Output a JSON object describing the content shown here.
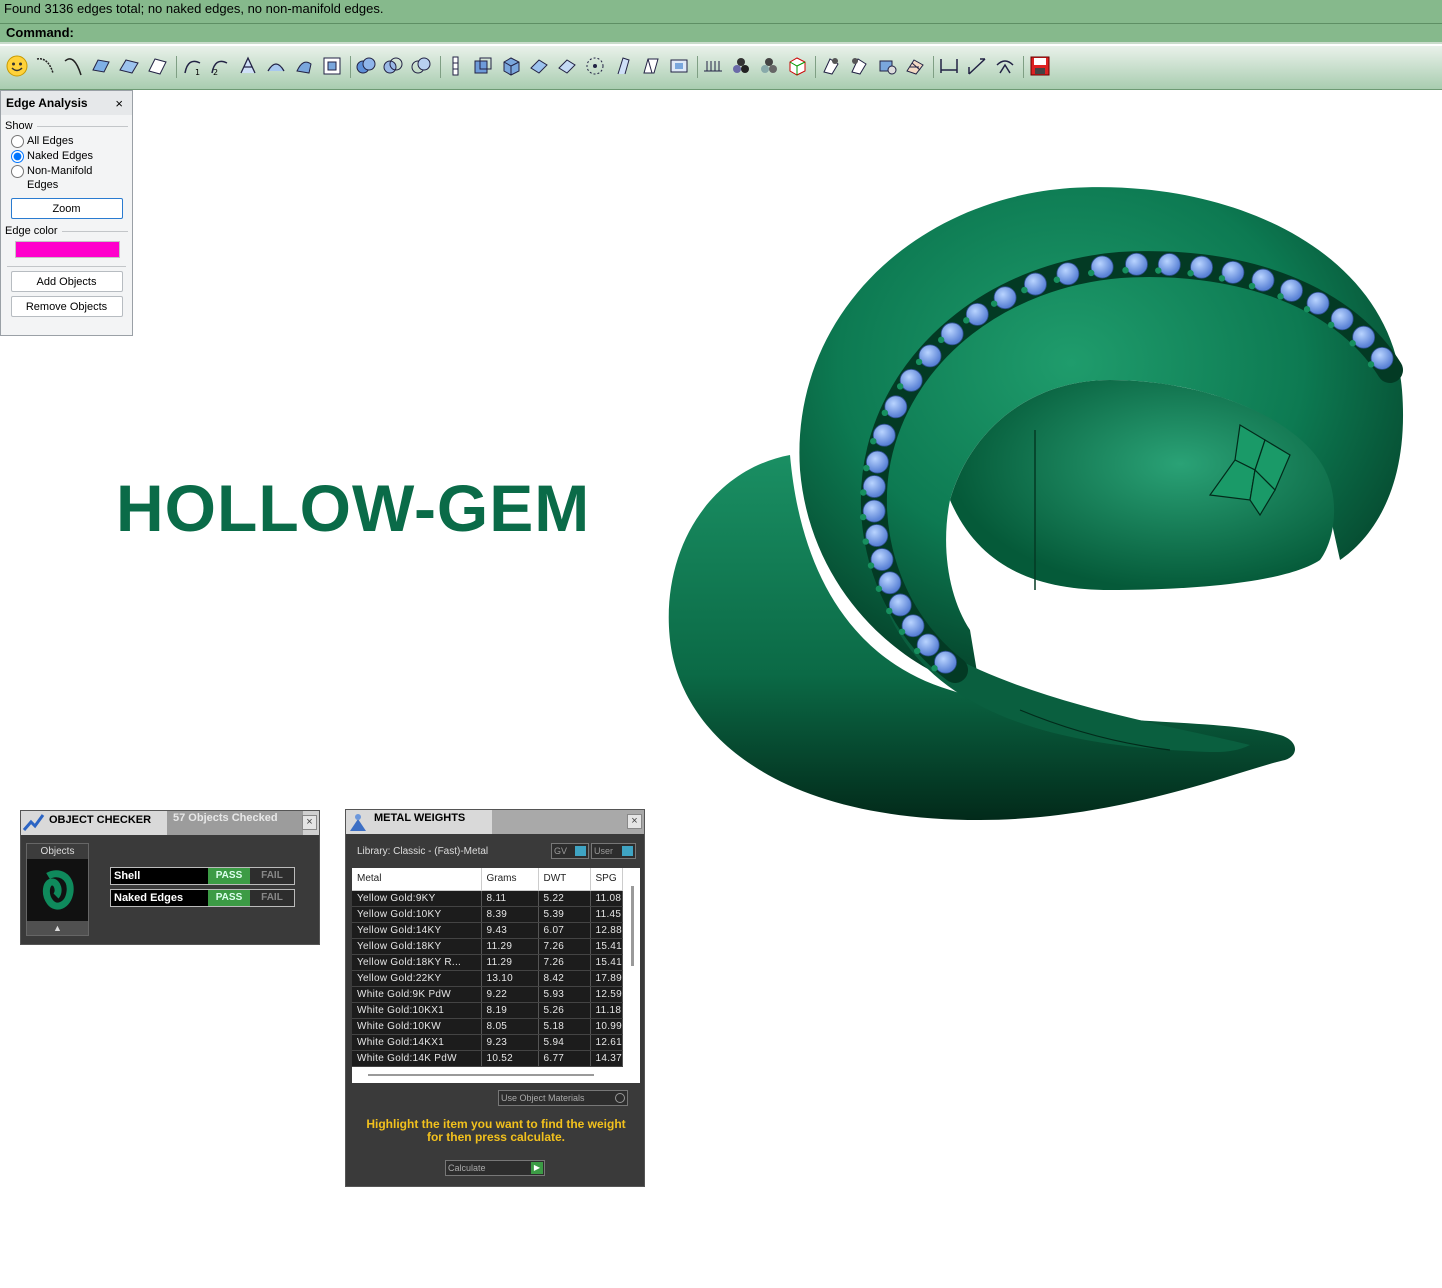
{
  "command": {
    "history": "Found 3136 edges total; no naked edges, no non-manifold edges.",
    "prompt": "Command:"
  },
  "toolbar": {
    "icons": [
      "smiley-icon",
      "curve-icon",
      "curve-icon",
      "surface-icon",
      "plane-icon",
      "plane-icon",
      "curve-icon",
      "curve-icon",
      "surface-icon",
      "surface-icon",
      "surface-icon",
      "snap-icon",
      "boolean-icon",
      "boolean-icon",
      "boolean-icon",
      "split-icon",
      "box-icon",
      "box-icon",
      "surface-icon",
      "surface-icon",
      "points-icon",
      "curve-icon",
      "surface-icon",
      "frame-icon",
      "grid-icon",
      "shade-icon",
      "shade-icon",
      "cube-icon",
      "tool-icon",
      "tool-icon",
      "tool-icon",
      "tool-icon",
      "dimension-icon",
      "dimension-icon",
      "dimension-icon",
      "save-icon"
    ]
  },
  "edge_analysis": {
    "title": "Edge Analysis",
    "close": "×",
    "show_label": "Show",
    "options": [
      "All Edges",
      "Naked Edges",
      "Non-Manifold Edges"
    ],
    "selected_option": "Naked Edges",
    "zoom_label": "Zoom",
    "edge_color_label": "Edge color",
    "edge_color": "#ff00cc",
    "add_objects_label": "Add Objects",
    "remove_objects_label": "Remove Objects"
  },
  "hero_title": "HOLLOW-GEM",
  "object_checker": {
    "title": "OBJECT CHECKER",
    "count_tab": "57 Objects Checked",
    "close": "×",
    "objects_label": "Objects",
    "scroll_up": "▲",
    "checks": [
      {
        "name": "Shell",
        "pass": "PASS",
        "fail": "FAIL"
      },
      {
        "name": "Naked Edges",
        "pass": "PASS",
        "fail": "FAIL"
      }
    ]
  },
  "metal_weights": {
    "title": "METAL WEIGHTS",
    "close": "×",
    "library": "Library: Classic - (Fast)-Metal",
    "toggle_gv": "GV",
    "toggle_user": "User",
    "columns": [
      "Metal",
      "Grams",
      "DWT",
      "SPG"
    ],
    "rows": [
      [
        "Yellow Gold:9KY",
        "8.11",
        "5.22",
        "11.08"
      ],
      [
        "Yellow Gold:10KY",
        "8.39",
        "5.39",
        "11.45"
      ],
      [
        "Yellow Gold:14KY",
        "9.43",
        "6.07",
        "12.88"
      ],
      [
        "Yellow Gold:18KY",
        "11.29",
        "7.26",
        "15.41"
      ],
      [
        "Yellow Gold:18KY R...",
        "11.29",
        "7.26",
        "15.41"
      ],
      [
        "Yellow Gold:22KY",
        "13.10",
        "8.42",
        "17.89"
      ],
      [
        "White Gold:9K PdW",
        "9.22",
        "5.93",
        "12.59"
      ],
      [
        "White Gold:10KX1",
        "8.19",
        "5.26",
        "11.18"
      ],
      [
        "White Gold:10KW",
        "8.05",
        "5.18",
        "10.99"
      ],
      [
        "White Gold:14KX1",
        "9.23",
        "5.94",
        "12.61"
      ],
      [
        "White Gold:14K PdW",
        "10.52",
        "6.77",
        "14.37"
      ]
    ],
    "use_object_materials": "Use Object Materials",
    "hint": "Highlight the item you want to find the weight for then press calculate.",
    "calculate_label": "Calculate",
    "calculate_arrow": "▶"
  }
}
